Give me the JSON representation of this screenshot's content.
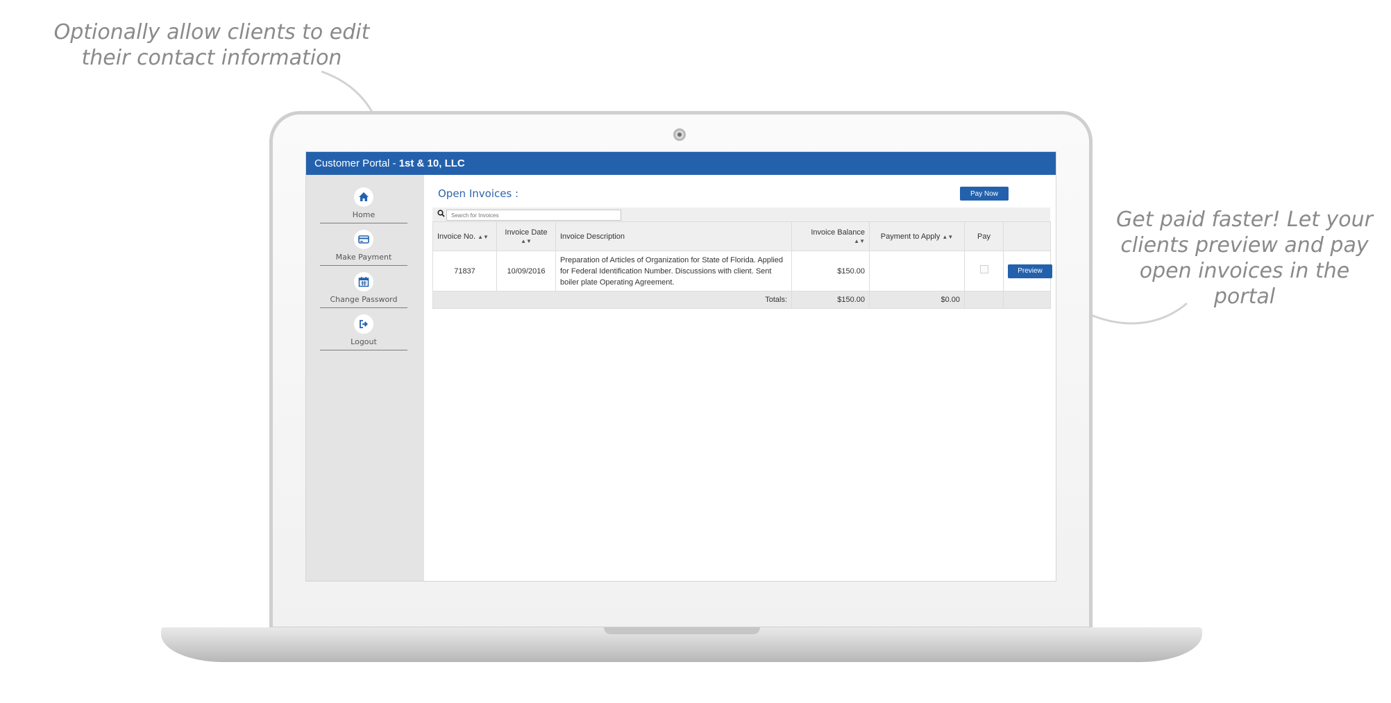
{
  "callouts": {
    "left": "Optionally allow clients to edit their contact information",
    "right": "Get paid faster! Let your clients preview and pay open invoices in the portal"
  },
  "header": {
    "portal_label": "Customer Portal - ",
    "company": "1st & 10, LLC"
  },
  "sidebar": {
    "items": [
      {
        "label": "Home",
        "icon": "home-icon"
      },
      {
        "label": "Make Payment",
        "icon": "credit-card-icon"
      },
      {
        "label": "Change Password",
        "icon": "calendar-icon"
      },
      {
        "label": "Logout",
        "icon": "logout-icon"
      }
    ]
  },
  "main": {
    "title": "Open Invoices :",
    "pay_now_label": "Pay Now",
    "search": {
      "placeholder": "Search for Invoices",
      "value": ""
    },
    "table": {
      "headers": {
        "invoice_no": "Invoice No.",
        "invoice_date": "Invoice Date",
        "description": "Invoice Description",
        "balance": "Invoice Balance",
        "payment": "Payment to Apply",
        "pay": "Pay"
      },
      "rows": [
        {
          "invoice_no": "71837",
          "invoice_date": "10/09/2016",
          "description": "Preparation of Articles of Organization for State of Florida. Applied for Federal Identification Number. Discussions with client. Sent boiler plate Operating Agreement.",
          "balance": "$150.00",
          "payment": "",
          "preview_label": "Preview"
        }
      ],
      "totals": {
        "label": "Totals:",
        "balance": "$150.00",
        "payment": "$0.00"
      }
    }
  },
  "colors": {
    "brand_blue": "#2461ad",
    "title_blue": "#2f64a8",
    "sidebar_gray": "#e4e4e4"
  }
}
